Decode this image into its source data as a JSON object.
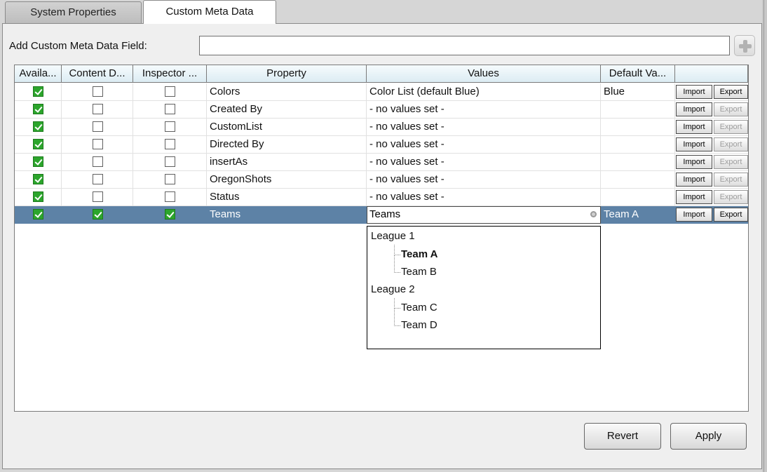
{
  "tabs": [
    {
      "label": "System Properties",
      "active": false
    },
    {
      "label": "Custom Meta Data",
      "active": true
    }
  ],
  "add_field": {
    "label": "Add Custom Meta Data Field:",
    "value": "",
    "add_icon": "plus-icon"
  },
  "columns": [
    "Availa...",
    "Content D...",
    "Inspector ...",
    "Property",
    "Values",
    "Default Va...",
    ""
  ],
  "rows": [
    {
      "property": "Colors",
      "values": "Color List (default Blue)",
      "default": "Blue",
      "available": true,
      "content": false,
      "inspector": false,
      "import": "Import",
      "export": "Export",
      "export_enabled": true
    },
    {
      "property": "Created By",
      "values": "- no values set -",
      "default": "",
      "available": true,
      "content": false,
      "inspector": false,
      "import": "Import",
      "export": "Export",
      "export_enabled": false
    },
    {
      "property": "CustomList",
      "values": "- no values set -",
      "default": "",
      "available": true,
      "content": false,
      "inspector": false,
      "import": "Import",
      "export": "Export",
      "export_enabled": false
    },
    {
      "property": "Directed By",
      "values": "- no values set -",
      "default": "",
      "available": true,
      "content": false,
      "inspector": false,
      "import": "Import",
      "export": "Export",
      "export_enabled": false
    },
    {
      "property": "insertAs",
      "values": "- no values set -",
      "default": "",
      "available": true,
      "content": false,
      "inspector": false,
      "import": "Import",
      "export": "Export",
      "export_enabled": false
    },
    {
      "property": "OregonShots",
      "values": "- no values set -",
      "default": "",
      "available": true,
      "content": false,
      "inspector": false,
      "import": "Import",
      "export": "Export",
      "export_enabled": false
    },
    {
      "property": "Status",
      "values": "- no values set -",
      "default": "",
      "available": true,
      "content": false,
      "inspector": false,
      "import": "Import",
      "export": "Export",
      "export_enabled": false
    },
    {
      "property": "Teams",
      "values": "Teams",
      "default": "Team A",
      "available": true,
      "content": true,
      "inspector": true,
      "import": "Import",
      "export": "Export",
      "export_enabled": true,
      "selected": true
    }
  ],
  "dropdown": {
    "items": [
      {
        "label": "League 1",
        "level": 0
      },
      {
        "label": "Team A",
        "level": 1,
        "bold": true
      },
      {
        "label": "Team B",
        "level": 1
      },
      {
        "label": "League 2",
        "level": 0
      },
      {
        "label": "Team C",
        "level": 1
      },
      {
        "label": "Team D",
        "level": 1
      }
    ]
  },
  "buttons": {
    "revert": "Revert",
    "apply": "Apply"
  },
  "colors": {
    "selection": "#5d82a6",
    "checkbox_on": "#2ca52c",
    "header": "#dcecf3"
  }
}
